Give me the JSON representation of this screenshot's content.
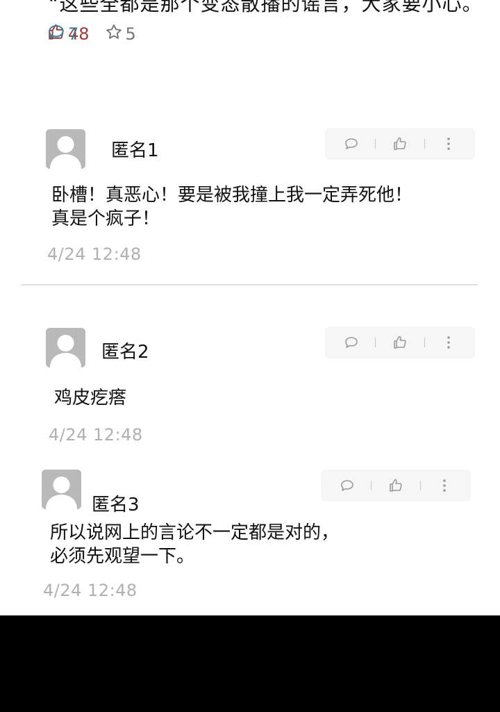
{
  "top_post": {
    "text": "“这些全都是那个变态散播的谣言，大家要小心。",
    "likes": "48",
    "comments": "7",
    "favorites": "5"
  },
  "comments": [
    {
      "user": "匿名1",
      "lines": [
        "卧槽！真恶心！要是被我撞上我一定弄死他！",
        "真是个疯子！"
      ],
      "time": "4/24  12:48"
    },
    {
      "user": "匿名2",
      "lines": [
        "鸡皮疙瘩"
      ],
      "time": "4/24  12:48"
    },
    {
      "user": "匿名3",
      "lines": [
        "所以说网上的言论不一定都是对的，",
        "必须先观望一下。"
      ],
      "time": "4/24  12:48"
    }
  ],
  "icons": {
    "like": "thumbs-up-icon",
    "comment": "speech-bubble-icon",
    "favorite": "star-icon",
    "more": "more-vertical-icon"
  },
  "colors": {
    "like": "#a33a35",
    "comment": "#2e7da3",
    "muted": "#b0b0b0",
    "avatar": "#b9b9b9"
  }
}
